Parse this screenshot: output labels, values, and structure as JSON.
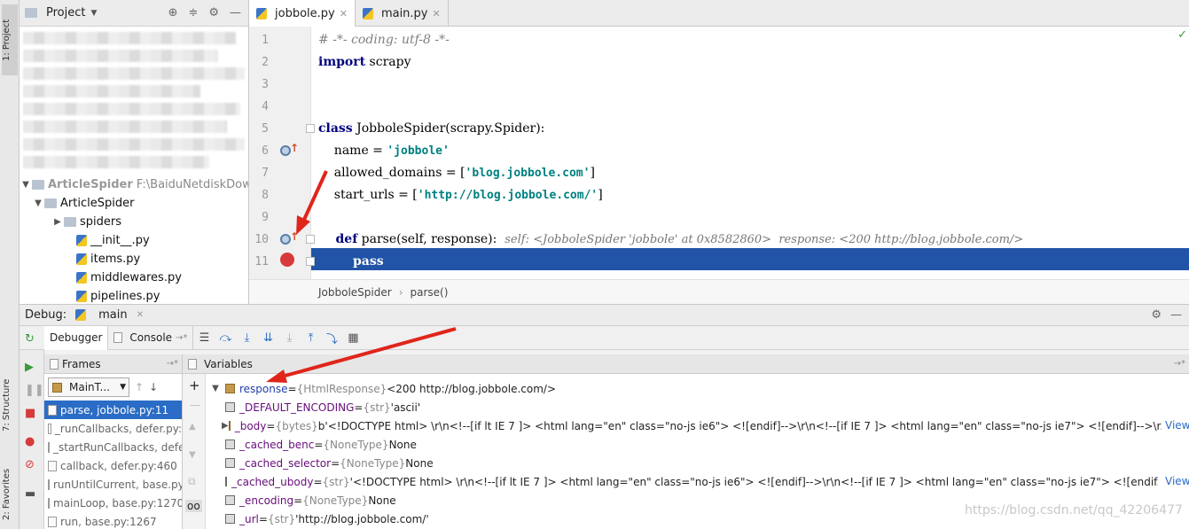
{
  "left_strip": {
    "project_tab": "1: Project",
    "structure_tab": "7: Structure",
    "favorites_tab": "2: Favorites"
  },
  "project_panel": {
    "title": "Project",
    "tree": [
      {
        "label": "ArticleSpider",
        "path": "F:\\BaiduNetdiskDownlo",
        "type": "root"
      },
      {
        "label": "ArticleSpider",
        "type": "folder"
      },
      {
        "label": "spiders",
        "type": "folder"
      },
      {
        "label": "__init__.py",
        "type": "file"
      },
      {
        "label": "items.py",
        "type": "file"
      },
      {
        "label": "middlewares.py",
        "type": "file"
      },
      {
        "label": "pipelines.py",
        "type": "file"
      }
    ]
  },
  "editor_tabs": [
    {
      "label": "jobbole.py",
      "active": true
    },
    {
      "label": "main.py",
      "active": false
    }
  ],
  "editor": {
    "lines": [
      {
        "num": "1"
      },
      {
        "num": "2"
      },
      {
        "num": "3"
      },
      {
        "num": "4"
      },
      {
        "num": "5"
      },
      {
        "num": "6"
      },
      {
        "num": "7"
      },
      {
        "num": "8"
      },
      {
        "num": "9"
      },
      {
        "num": "10"
      },
      {
        "num": "11"
      }
    ],
    "code": {
      "l1": "# -*- coding: utf-8 -*-",
      "l2_kw": "import",
      "l2_rest": " scrapy",
      "l5_kw": "class",
      "l5_rest": " JobboleSpider(scrapy.Spider):",
      "l6_a": "    name = ",
      "l6_s": "'jobbole'",
      "l7_a": "    allowed_domains = [",
      "l7_s": "'blog.jobbole.com'",
      "l7_b": "]",
      "l8_a": "    start_urls = [",
      "l8_s": "'http://blog.jobbole.com/'",
      "l8_b": "]",
      "l10_kw": "    def",
      "l10_rest": " parse(self, response):",
      "l10_hint": "self: <JobboleSpider 'jobbole' at 0x8582860>  response: <200 http://blog.jobbole.com/>",
      "l11_kw": "        pass"
    },
    "breadcrumb": [
      "JobboleSpider",
      "parse()"
    ]
  },
  "debug": {
    "title": "Debug:",
    "run_config": "main",
    "tabs": [
      "Debugger",
      "Console"
    ],
    "frames_title": "Frames",
    "thread": "MainT...",
    "frames": [
      "parse, jobbole.py:11",
      "_runCallbacks, defer.py:",
      "_startRunCallbacks, defe",
      "callback, defer.py:460",
      "runUntilCurrent, base.py",
      "mainLoop, base.py:1270",
      "run, base.py:1267"
    ],
    "variables_title": "Variables",
    "variables": [
      {
        "name": "response",
        "eq": " = ",
        "type": "{HtmlResponse}",
        "value": " <200 http://blog.jobbole.com/>",
        "view": ""
      },
      {
        "name": "_DEFAULT_ENCODING",
        "eq": " = ",
        "type": "{str}",
        "value": " 'ascii'",
        "view": ""
      },
      {
        "name": "_body",
        "eq": " = ",
        "type": "{bytes}",
        "value": " b'<!DOCTYPE html>    \\r\\n<!--[if lt IE 7 ]>  <html lang=\"en\" class=\"no-js ie6\">  <![endif]-->\\r\\n<!--[if IE 7 ]>  <html lang=\"en\" class=\"no-js ie7\">  <![endif]-->\\r...",
        "view": "View"
      },
      {
        "name": "_cached_benc",
        "eq": " = ",
        "type": "{NoneType}",
        "value": " None",
        "view": ""
      },
      {
        "name": "_cached_selector",
        "eq": " = ",
        "type": "{NoneType}",
        "value": " None",
        "view": ""
      },
      {
        "name": "_cached_ubody",
        "eq": " = ",
        "type": "{str}",
        "value": " '<!DOCTYPE html>    \\r\\n<!--[if lt IE 7 ]>  <html lang=\"en\" class=\"no-js ie6\">  <![endif]-->\\r\\n<!--[if IE 7 ]>  <html lang=\"en\" class=\"no-js ie7\">  <![endif...",
        "view": "View"
      },
      {
        "name": "_encoding",
        "eq": " = ",
        "type": "{NoneType}",
        "value": " None",
        "view": ""
      },
      {
        "name": "_url",
        "eq": " = ",
        "type": "{str}",
        "value": " 'http://blog.jobbole.com/'",
        "view": ""
      }
    ]
  },
  "watermark": "https://blog.csdn.net/qq_42206477",
  "colors": {
    "selection": "#2154a6",
    "breakpoint": "#d73a3a",
    "annotation_arrow": "#e0251b"
  }
}
